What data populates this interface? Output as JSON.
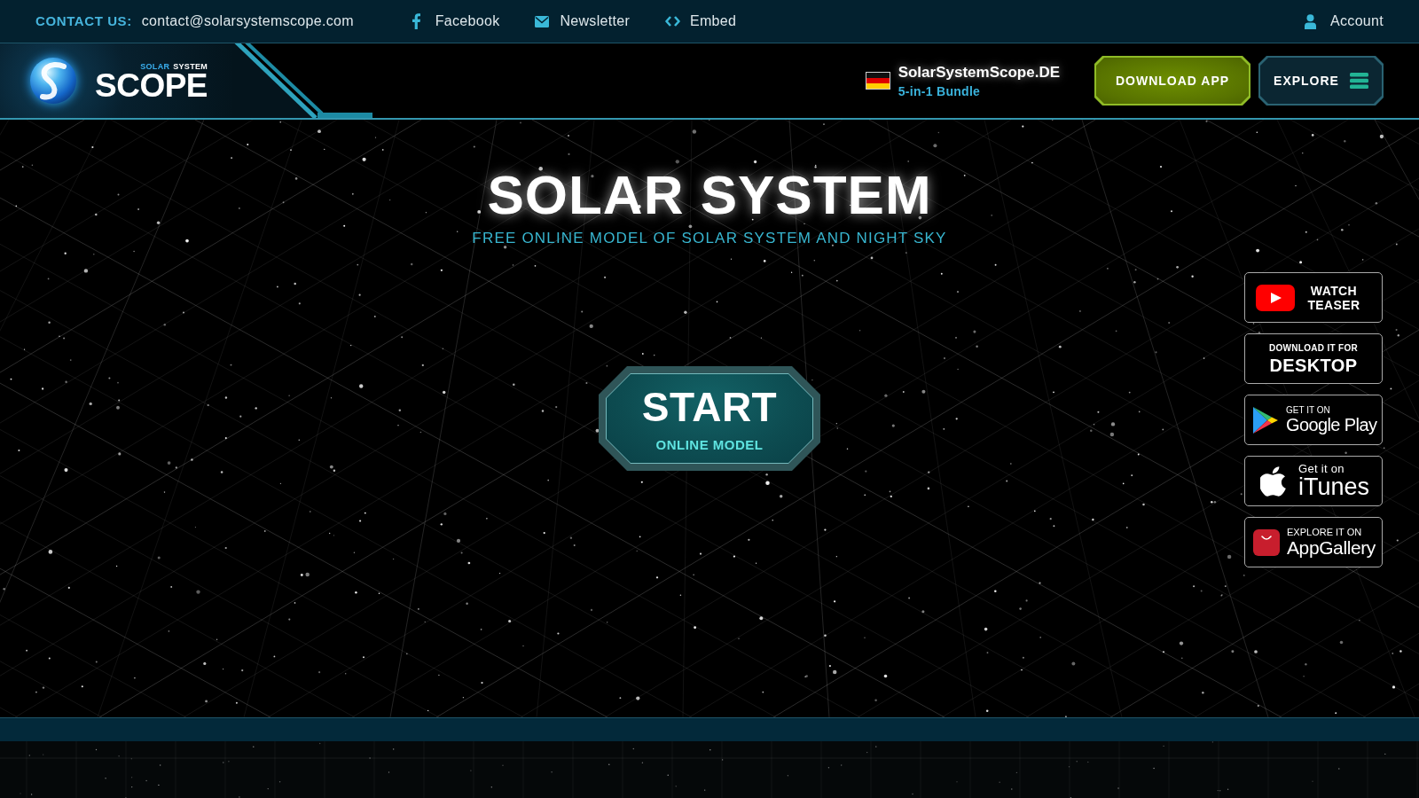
{
  "top_bar": {
    "contact_label": "CONTACT US:",
    "contact_email": "contact@solarsystemscope.com",
    "links": [
      {
        "kind": "facebook",
        "label": "Facebook"
      },
      {
        "kind": "newsletter",
        "label": "Newsletter"
      },
      {
        "kind": "embed",
        "label": "Embed"
      }
    ],
    "account": "Account"
  },
  "header": {
    "logo": {
      "caption": [
        "SOLAR",
        "SYSTEM"
      ],
      "name": "SCOPE"
    },
    "promo": {
      "site": "SolarSystemScope.DE",
      "subtitle": "5-in-1 Bundle"
    },
    "buttons": [
      {
        "kind": "download",
        "label": "DOWNLOAD APP"
      },
      {
        "kind": "explore",
        "label": "EXPLORE"
      }
    ]
  },
  "hero": {
    "title": "SOLAR SYSTEM",
    "subtitle": "FREE ONLINE MODEL OF SOLAR SYSTEM AND NIGHT SKY",
    "start": {
      "label": "START",
      "sublabel": "ONLINE MODEL"
    }
  },
  "side_buttons": [
    {
      "kind": "youtube",
      "lines": [
        "WATCH",
        "TEASER"
      ]
    },
    {
      "kind": "desktop",
      "lines": [
        "DOWNLOAD IT FOR",
        "DESKTOP"
      ]
    },
    {
      "kind": "google_play",
      "lines": [
        "GET IT ON",
        "Google Play"
      ]
    },
    {
      "kind": "itunes",
      "lines": [
        "Get it on",
        "iTunes"
      ]
    },
    {
      "kind": "appgallery",
      "lines": [
        "EXPLORE IT ON",
        "AppGallery"
      ]
    }
  ]
}
